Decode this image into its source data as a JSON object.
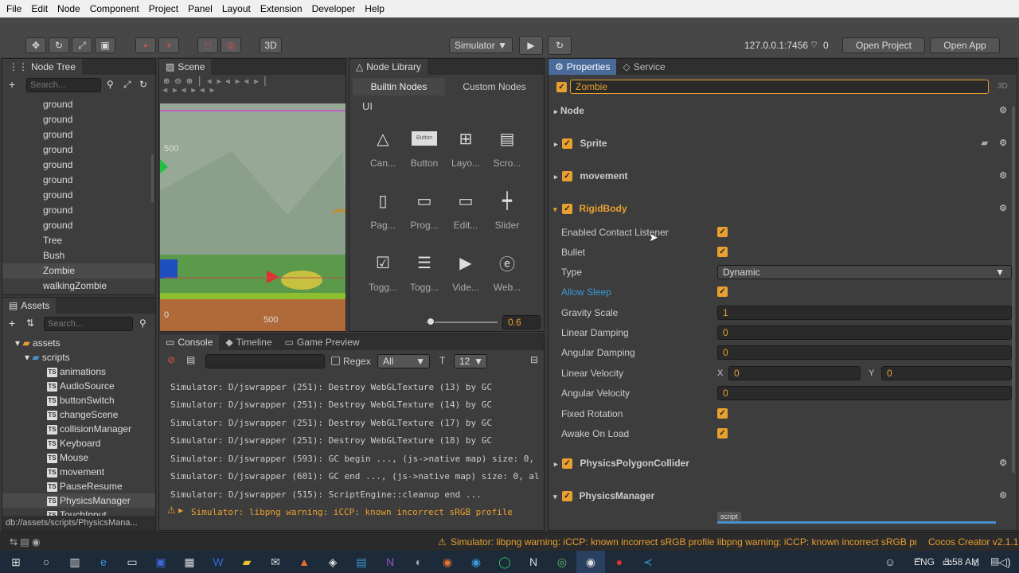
{
  "menu": [
    "File",
    "Edit",
    "Node",
    "Component",
    "Project",
    "Panel",
    "Layout",
    "Extension",
    "Developer",
    "Help"
  ],
  "toolbar": {
    "mode_3d": "3D",
    "platform": "Simulator",
    "ip": "127.0.0.1:7456",
    "wifi_count": "0",
    "open_project": "Open Project",
    "open_app": "Open App"
  },
  "node_tree": {
    "title": "Node Tree",
    "search_placeholder": "Search...",
    "items": [
      "ground",
      "ground",
      "ground",
      "ground",
      "ground",
      "ground",
      "ground",
      "ground",
      "ground",
      "Tree",
      "Bush",
      "Zombie",
      "walkingZombie"
    ],
    "selected_index": 11
  },
  "scene": {
    "title": "Scene",
    "label_500_y": "500",
    "label_0": "0",
    "label_500_x": "500"
  },
  "node_library": {
    "title": "Node Library",
    "tab_builtin": "Builtin Nodes",
    "tab_custom": "Custom Nodes",
    "section": "UI",
    "tiles": [
      "Can...",
      "Button",
      "Layo...",
      "Scro...",
      "Pag...",
      "Prog...",
      "Edit...",
      "Slider",
      "Togg...",
      "Togg...",
      "Vide...",
      "Web..."
    ],
    "button_tile_text": "Button",
    "zoom_value": "0.6"
  },
  "assets": {
    "title": "Assets",
    "search_placeholder": "Search...",
    "root": "assets",
    "folder": "scripts",
    "files": [
      "animations",
      "AudioSource",
      "buttonSwitch",
      "changeScene",
      "collisionManager",
      "Keyboard",
      "Mouse",
      "movement",
      "PauseResume",
      "PhysicsManager",
      "TouchInput"
    ],
    "selected_file": "PhysicsManager",
    "ts_label": "TS",
    "path": "db://assets/scripts/PhysicsMana..."
  },
  "console": {
    "tab_console": "Console",
    "tab_timeline": "Timeline",
    "tab_game_preview": "Game Preview",
    "regex_label": "Regex",
    "filter_value": "All",
    "font_size": "12",
    "lines": [
      "Simulator: D/jswrapper (251): Destroy WebGLTexture (13) by GC",
      "Simulator: D/jswrapper (251): Destroy WebGLTexture (14) by GC",
      "Simulator: D/jswrapper (251): Destroy WebGLTexture (17) by GC",
      "Simulator: D/jswrapper (251): Destroy WebGLTexture (18) by GC",
      "Simulator: D/jswrapper (593): GC begin ..., (js->native map) size: 0,",
      "Simulator: D/jswrapper (601): GC end ..., (js->native map) size: 0, al",
      "Simulator: D/jswrapper (515): ScriptEngine::cleanup end ..."
    ],
    "warning": "Simulator: libpng warning: iCCP: known incorrect sRGB profile"
  },
  "properties": {
    "tab_properties": "Properties",
    "tab_service": "Service",
    "node_name": "Zombie",
    "label_3d": "3D",
    "components": {
      "node": "Node",
      "sprite": "Sprite",
      "movement": "movement",
      "rigidbody": "RigidBody",
      "polygon": "PhysicsPolygonCollider",
      "physicsmanager": "PhysicsManager"
    },
    "rigidbody_fields": {
      "enabled_contact_listener": "Enabled Contact Listener",
      "bullet": "Bullet",
      "type": "Type",
      "type_value": "Dynamic",
      "allow_sleep": "Allow Sleep",
      "gravity_scale": "Gravity Scale",
      "gravity_scale_value": "1",
      "linear_damping": "Linear Damping",
      "linear_damping_value": "0",
      "angular_damping": "Angular Damping",
      "angular_damping_value": "0",
      "linear_velocity": "Linear Velocity",
      "lv_x_label": "X",
      "lv_x_value": "0",
      "lv_y_label": "Y",
      "lv_y_value": "0",
      "angular_velocity": "Angular Velocity",
      "angular_velocity_value": "0",
      "fixed_rotation": "Fixed Rotation",
      "awake_on_load": "Awake On Load"
    },
    "script_tag": "script"
  },
  "statusbar": {
    "message": "Simulator: libpng warning: iCCP: known incorrect sRGB profile libpng warning: iCCP: known incorrect sRGB profile",
    "version": "Cocos Creator v2.1.1"
  },
  "taskbar": {
    "lang": "ENG",
    "time": "3:58 AM"
  },
  "colors": {
    "accent": "#e8a030",
    "selected_tab": "#4a6a9a",
    "link": "#3a9ad9"
  }
}
